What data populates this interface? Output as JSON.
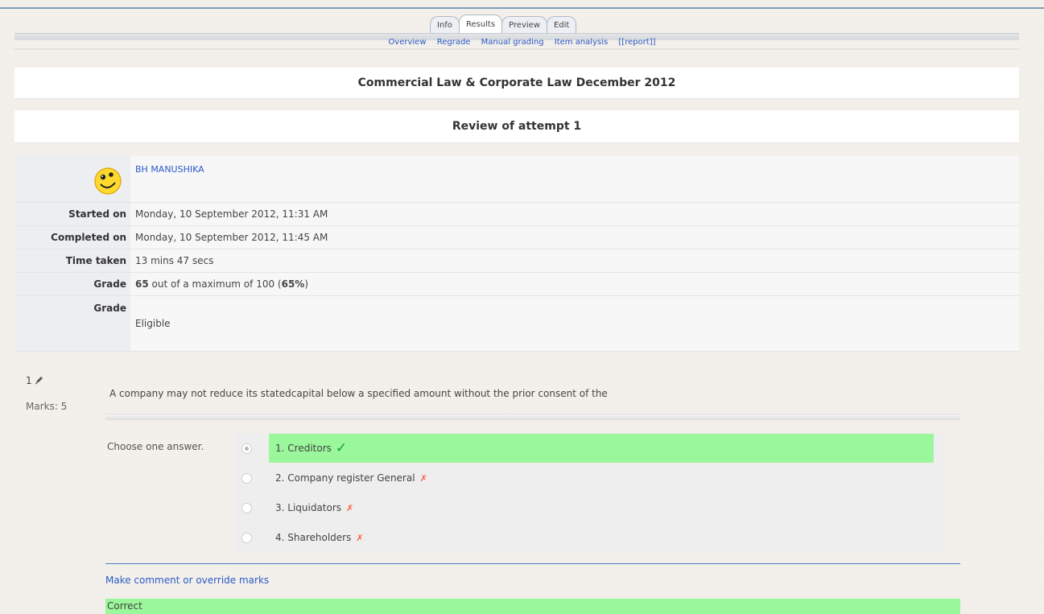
{
  "tabs": [
    {
      "label": "Info"
    },
    {
      "label": "Results"
    },
    {
      "label": "Preview"
    },
    {
      "label": "Edit"
    }
  ],
  "subnav": [
    "Overview",
    "Regrade",
    "Manual grading",
    "Item analysis",
    "[[report]]"
  ],
  "quiz_title": "Commercial Law & Corporate Law December 2012",
  "review_title": "Review of attempt 1",
  "user": {
    "name": "BH MANUSHIKA",
    "avatar_icon": "smiley-avatar-icon"
  },
  "info": {
    "started_label": "Started on",
    "started_value": "Monday, 10 September 2012, 11:31 AM",
    "completed_label": "Completed on",
    "completed_value": "Monday, 10 September 2012, 11:45 AM",
    "time_label": "Time taken",
    "time_value": "13 mins 47 secs",
    "grade_label": "Grade",
    "grade_score": "65",
    "grade_mid": " out of a maximum of 100 (",
    "grade_pct": "65%",
    "grade_end": ")",
    "grade2_label": "Grade",
    "grade2_value": "Eligible"
  },
  "question": {
    "number": "1",
    "edit_icon": "edit-pencil-icon",
    "marks": "Marks: 5",
    "text": "A company may not reduce its statedcapital below a specified amount without the prior consent of the",
    "choose_label": "Choose one answer.",
    "answers": [
      {
        "label": "1. Creditors",
        "mark": "✓",
        "correct": true,
        "selected": true
      },
      {
        "label": "2. Company register General",
        "mark": "✗",
        "correct": false,
        "selected": false
      },
      {
        "label": "3. Liquidators",
        "mark": "✗",
        "correct": false,
        "selected": false
      },
      {
        "label": "4. Shareholders",
        "mark": "✗",
        "correct": false,
        "selected": false
      }
    ],
    "comment_link": "Make comment or override marks",
    "feedback": "Correct"
  },
  "colors": {
    "correct_bg": "#9bf79b",
    "link": "#2a5bc8",
    "tick": "#12a02b",
    "cross": "#ff5a3b"
  }
}
